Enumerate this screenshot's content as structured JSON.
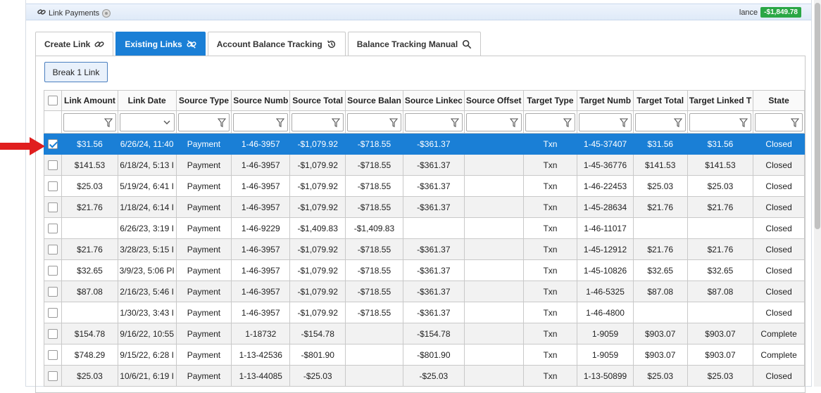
{
  "header": {
    "title": "Link Payments",
    "balance_label": "lance",
    "balance_value": "-$1,849.78"
  },
  "tabs": [
    {
      "label": "Create Link",
      "icon": "link-icon"
    },
    {
      "label": "Existing Links",
      "icon": "link-broken-icon"
    },
    {
      "label": "Account Balance Tracking",
      "icon": "history-icon"
    },
    {
      "label": "Balance Tracking Manual",
      "icon": "search-icon"
    }
  ],
  "toolbar": {
    "break_label": "Break 1 Link"
  },
  "grid": {
    "columns": [
      "Link Amount",
      "Link Date",
      "Source Type",
      "Source Numb",
      "Source Total",
      "Source Balan",
      "Source Linkec",
      "Source Offset",
      "Target Type",
      "Target Numb",
      "Target Total",
      "Target Linked T",
      "State"
    ],
    "rows": [
      [
        "$31.56",
        "6/26/24, 11:40",
        "Payment",
        "1-46-3957",
        "-$1,079.92",
        "-$718.55",
        "-$361.37",
        "",
        "Txn",
        "1-45-37407",
        "$31.56",
        "$31.56",
        "Closed"
      ],
      [
        "$141.53",
        "6/18/24, 5:13 I",
        "Payment",
        "1-46-3957",
        "-$1,079.92",
        "-$718.55",
        "-$361.37",
        "",
        "Txn",
        "1-45-36776",
        "$141.53",
        "$141.53",
        "Closed"
      ],
      [
        "$25.03",
        "5/19/24, 6:41 I",
        "Payment",
        "1-46-3957",
        "-$1,079.92",
        "-$718.55",
        "-$361.37",
        "",
        "Txn",
        "1-46-22453",
        "$25.03",
        "$25.03",
        "Closed"
      ],
      [
        "$21.76",
        "1/18/24, 6:14 I",
        "Payment",
        "1-46-3957",
        "-$1,079.92",
        "-$718.55",
        "-$361.37",
        "",
        "Txn",
        "1-45-28634",
        "$21.76",
        "$21.76",
        "Closed"
      ],
      [
        "",
        "6/26/23, 3:19 I",
        "Payment",
        "1-46-9229",
        "-$1,409.83",
        "-$1,409.83",
        "",
        "",
        "Txn",
        "1-46-11017",
        "",
        "",
        "Closed"
      ],
      [
        "$21.76",
        "3/28/23, 5:15 I",
        "Payment",
        "1-46-3957",
        "-$1,079.92",
        "-$718.55",
        "-$361.37",
        "",
        "Txn",
        "1-45-12912",
        "$21.76",
        "$21.76",
        "Closed"
      ],
      [
        "$32.65",
        "3/9/23, 5:06 PI",
        "Payment",
        "1-46-3957",
        "-$1,079.92",
        "-$718.55",
        "-$361.37",
        "",
        "Txn",
        "1-45-10826",
        "$32.65",
        "$32.65",
        "Closed"
      ],
      [
        "$87.08",
        "2/16/23, 5:46 I",
        "Payment",
        "1-46-3957",
        "-$1,079.92",
        "-$718.55",
        "-$361.37",
        "",
        "Txn",
        "1-46-5325",
        "$87.08",
        "$87.08",
        "Closed"
      ],
      [
        "",
        "1/30/23, 3:43 I",
        "Payment",
        "1-46-3957",
        "-$1,079.92",
        "-$718.55",
        "-$361.37",
        "",
        "Txn",
        "1-46-4800",
        "",
        "",
        "Closed"
      ],
      [
        "$154.78",
        "9/16/22, 10:55",
        "Payment",
        "1-18732",
        "-$154.78",
        "",
        "-$154.78",
        "",
        "Txn",
        "1-9059",
        "$903.07",
        "$903.07",
        "Complete"
      ],
      [
        "$748.29",
        "9/15/22, 6:28 I",
        "Payment",
        "1-13-42536",
        "-$801.90",
        "",
        "-$801.90",
        "",
        "Txn",
        "1-9059",
        "$903.07",
        "$903.07",
        "Complete"
      ],
      [
        "$25.03",
        "10/6/21, 6:19 I",
        "Payment",
        "1-13-44085",
        "-$25.03",
        "",
        "-$25.03",
        "",
        "Txn",
        "1-13-50899",
        "$25.03",
        "$25.03",
        "Closed"
      ]
    ]
  },
  "colors": {
    "accent": "#1a7fd6",
    "balance_badge": "#2aa745",
    "arrow": "#e01e1e"
  }
}
